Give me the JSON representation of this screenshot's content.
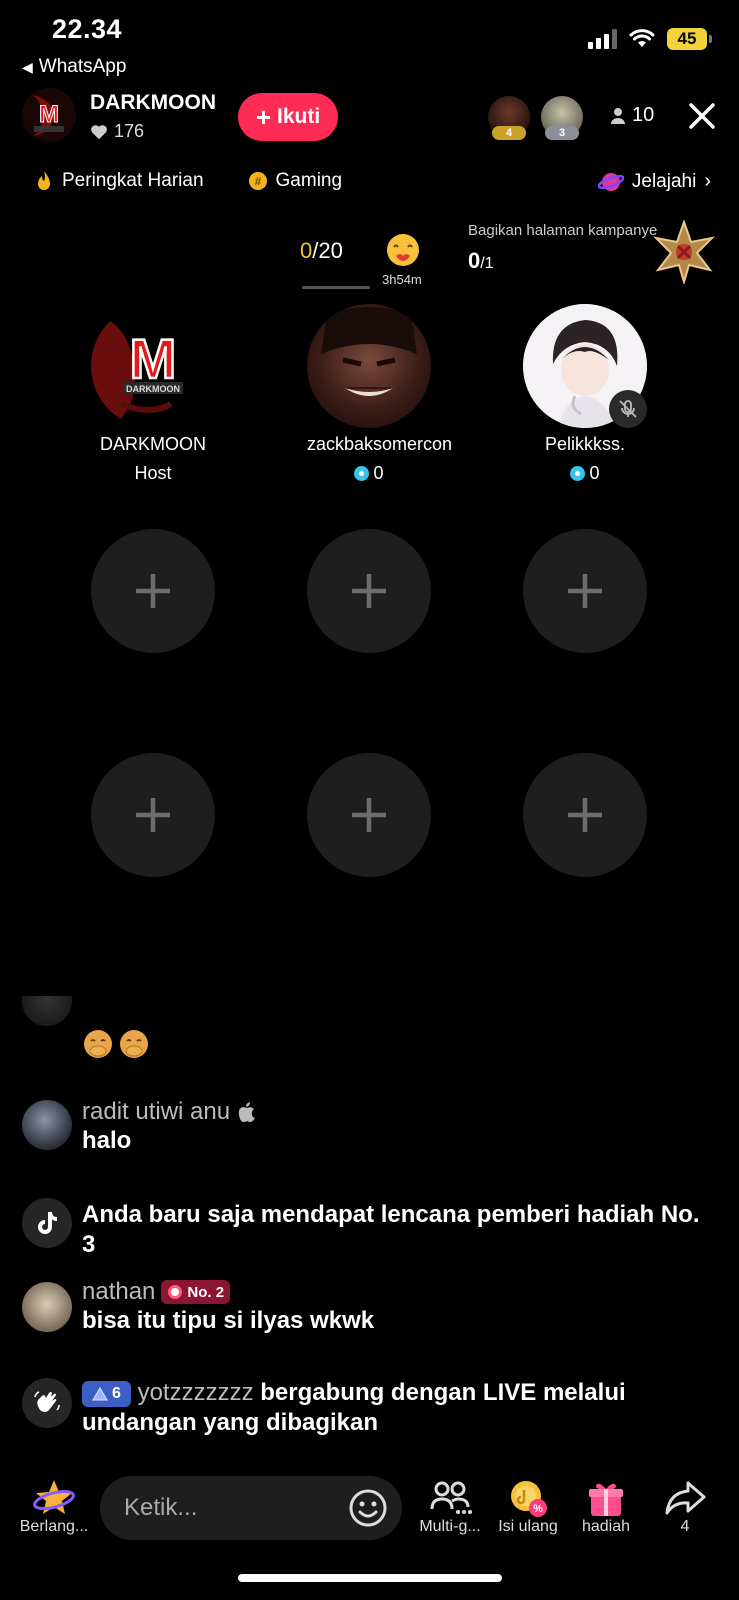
{
  "status": {
    "time": "22.34",
    "back_label": "WhatsApp",
    "battery": "45"
  },
  "header": {
    "host_name": "DARKMOON",
    "likes": "176",
    "follow_label": "Ikuti",
    "top_rank": [
      {
        "rank": "4"
      },
      {
        "rank": "3"
      }
    ],
    "viewers": "10"
  },
  "categories": {
    "daily_rank": "Peringkat Harian",
    "gaming": "Gaming",
    "explore": "Jelajahi"
  },
  "goal": {
    "current": "0",
    "total": "/20",
    "time_left": "3h54m"
  },
  "campaign": {
    "text": "Bagikan halaman kampanye",
    "current": "0",
    "total": "/1"
  },
  "seats": [
    {
      "name": "DARKMOON",
      "sub": "Host"
    },
    {
      "name": "zackbaksomercon",
      "diamonds": "0"
    },
    {
      "name": "Pelikkkss.",
      "diamonds": "0"
    }
  ],
  "chat": [
    {
      "name": "radit utiwi anu",
      "message": "halo"
    },
    {
      "message": "Anda baru saja mendapat lencana pemberi hadiah No. 3"
    },
    {
      "name": "nathan",
      "badge": "No. 2",
      "message": "bisa itu tipu si ilyas wkwk"
    },
    {
      "level": "6",
      "name": "yotzzzzzzz",
      "message": "bergabung dengan LIVE melalui undangan yang dibagikan"
    }
  ],
  "bottom": {
    "berlangganan": "Berlang...",
    "placeholder": "Ketik...",
    "multi": "Multi-g...",
    "isi_ulang": "Isi ulang",
    "hadiah": "hadiah",
    "share_count": "4"
  }
}
